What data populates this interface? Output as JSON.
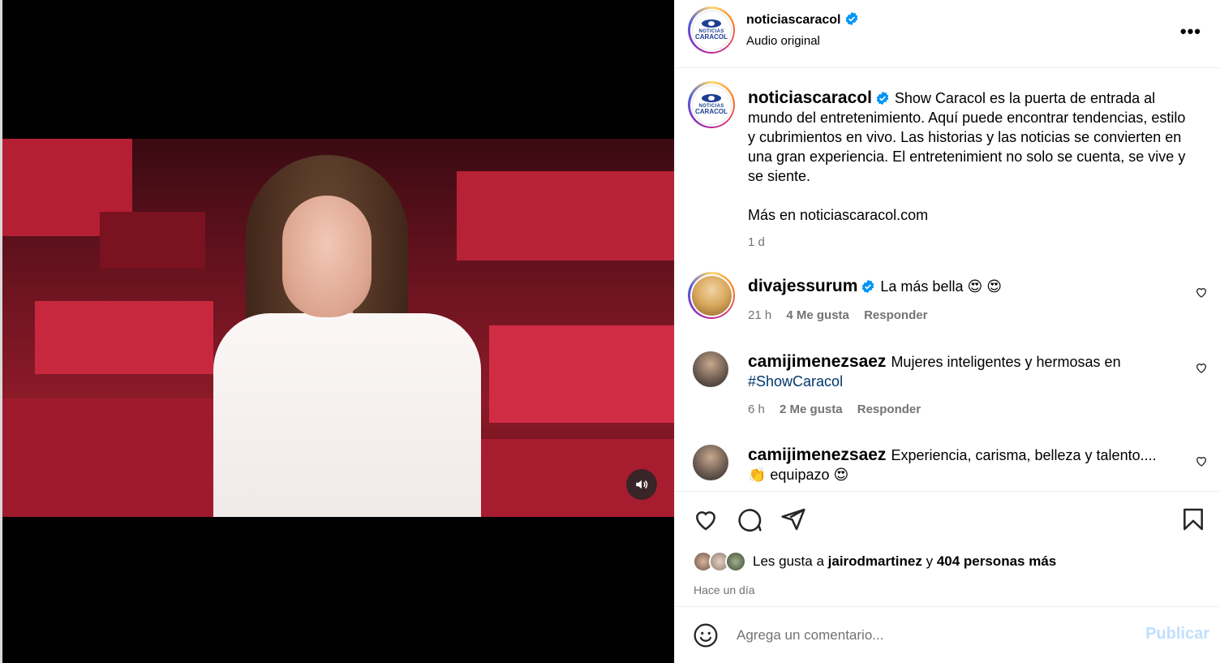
{
  "post": {
    "account": "noticiascaracol",
    "audio": "Audio original",
    "logo_line1": "NOTICIAS",
    "logo_line2": "CARACOL"
  },
  "caption": {
    "username": "noticiascaracol",
    "text": "Show Caracol es la puerta de entrada al mundo del entretenimiento. Aquí puede encontrar tendencias, estilo y cubrimientos en vivo. Las historias y las noticias se convierten en una gran experiencia. El entretenimient no solo se cuenta, se vive y se siente.",
    "link_text": "Más en noticiascaracol.com",
    "time": "1 d"
  },
  "comments": [
    {
      "username": "divajessurum",
      "text": "La más bella 😍 😍",
      "time": "21 h",
      "likes": "4 Me gusta",
      "reply": "Responder"
    },
    {
      "username": "camijimenezsaez",
      "text": "Mujeres inteligentes y hermosas en",
      "hashtag": "#ShowCaracol",
      "time": "6 h",
      "likes": "2 Me gusta",
      "reply": "Responder"
    },
    {
      "username": "camijimenezsaez",
      "text": "Experiencia, carisma, belleza y talento....",
      "text2": "👏 equipazo 😍"
    }
  ],
  "likes_summary": {
    "prefix": "Les gusta a",
    "user": "jairodmartinez",
    "joiner": "y",
    "others": "404 personas más",
    "time_ago": "Hace un día"
  },
  "composer": {
    "placeholder": "Agrega un comentario...",
    "publish": "Publicar"
  },
  "icons": {
    "more": "more-options-icon",
    "verified": "verified-badge-icon",
    "like": "heart-icon",
    "comment": "comment-icon",
    "share": "share-icon",
    "save": "bookmark-icon",
    "emoji": "emoji-icon",
    "mute": "volume-icon"
  },
  "colors": {
    "verified": "#0095f6",
    "meta_gray": "#737373",
    "publish_disabled": "#c0dffd",
    "hashtag": "#00376b"
  }
}
